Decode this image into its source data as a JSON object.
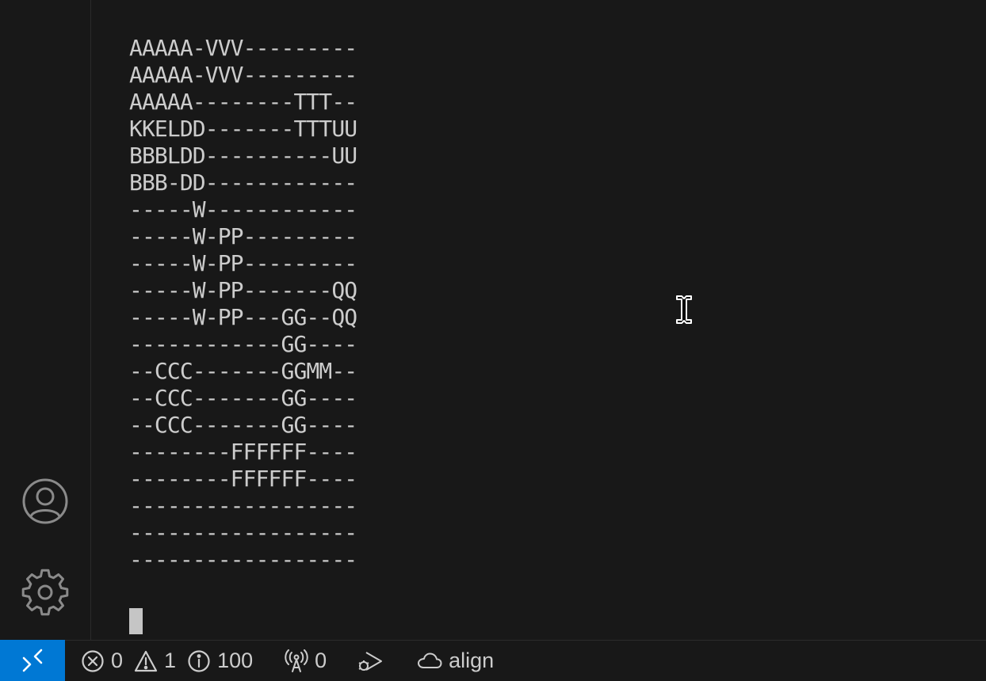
{
  "terminal": {
    "lines": [
      "------------------",
      "",
      "AAAAA-VVV---------",
      "AAAAA-VVV---------",
      "AAAAA--------TTT--",
      "KKELDD-------TTTUU",
      "BBBLDD----------UU",
      "BBB-DD------------",
      "-----W------------",
      "-----W-PP---------",
      "-----W-PP---------",
      "-----W-PP-------QQ",
      "-----W-PP---GG--QQ",
      "------------GG----",
      "--CCC-------GGMM--",
      "--CCC-------GG----",
      "--CCC-------GG----",
      "--------FFFFFF----",
      "--------FFFFFF----",
      "------------------",
      "------------------",
      "------------------"
    ]
  },
  "activity_bar": {
    "account_icon": "account-icon",
    "settings_icon": "gear-icon"
  },
  "status_bar": {
    "remote_icon": "remote-icon",
    "errors": "0",
    "warnings": "1",
    "infos": "100",
    "ports": "0",
    "debug_icon": "debug-run-icon",
    "cloud_label": "align"
  },
  "colors": {
    "background": "#181818",
    "remote_accent": "#0078d4",
    "text": "#cccccc"
  }
}
